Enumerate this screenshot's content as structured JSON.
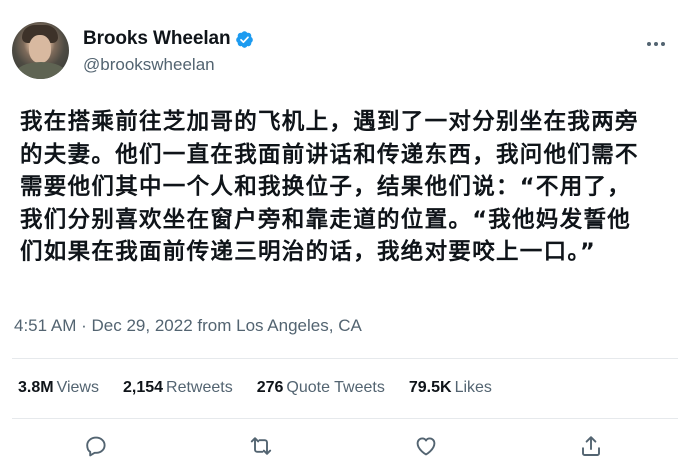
{
  "user": {
    "display_name": "Brooks Wheelan",
    "handle": "@brookswheelan",
    "verified": true,
    "avatar_icon": "avatar-photo",
    "verified_icon": "verified-badge-icon",
    "accent_color": "#1d9bf0"
  },
  "tweet": {
    "lines": [
      "我在搭乘前往芝加哥的飞机上，遇到了一对分别坐在我两旁",
      "的夫妻。他们一直在我面前讲话和传递东西，我问他们需不",
      "需要他们其中一个人和我换位子，结果他们说：“不用了，",
      "我们分别喜欢坐在窗户旁和靠走道的位置。“我他妈发誓他",
      "们如果在我面前传递三明治的话，我绝对要咬上一口。”"
    ]
  },
  "timestamp": {
    "time": "4:51 AM",
    "separator": "·",
    "date": "Dec 29, 2022",
    "location": "from Los Angeles, CA"
  },
  "stats": [
    {
      "value": "3.8M",
      "label": "Views"
    },
    {
      "value": "2,154",
      "label": "Retweets"
    },
    {
      "value": "276",
      "label": "Quote Tweets"
    },
    {
      "value": "79.5K",
      "label": "Likes"
    }
  ],
  "actions": [
    {
      "icon": "reply-icon"
    },
    {
      "icon": "retweet-icon"
    },
    {
      "icon": "like-icon"
    },
    {
      "icon": "share-icon"
    }
  ],
  "colors": {
    "text_primary": "#0f1419",
    "text_secondary": "#536471",
    "divider": "#e6e9ec"
  }
}
